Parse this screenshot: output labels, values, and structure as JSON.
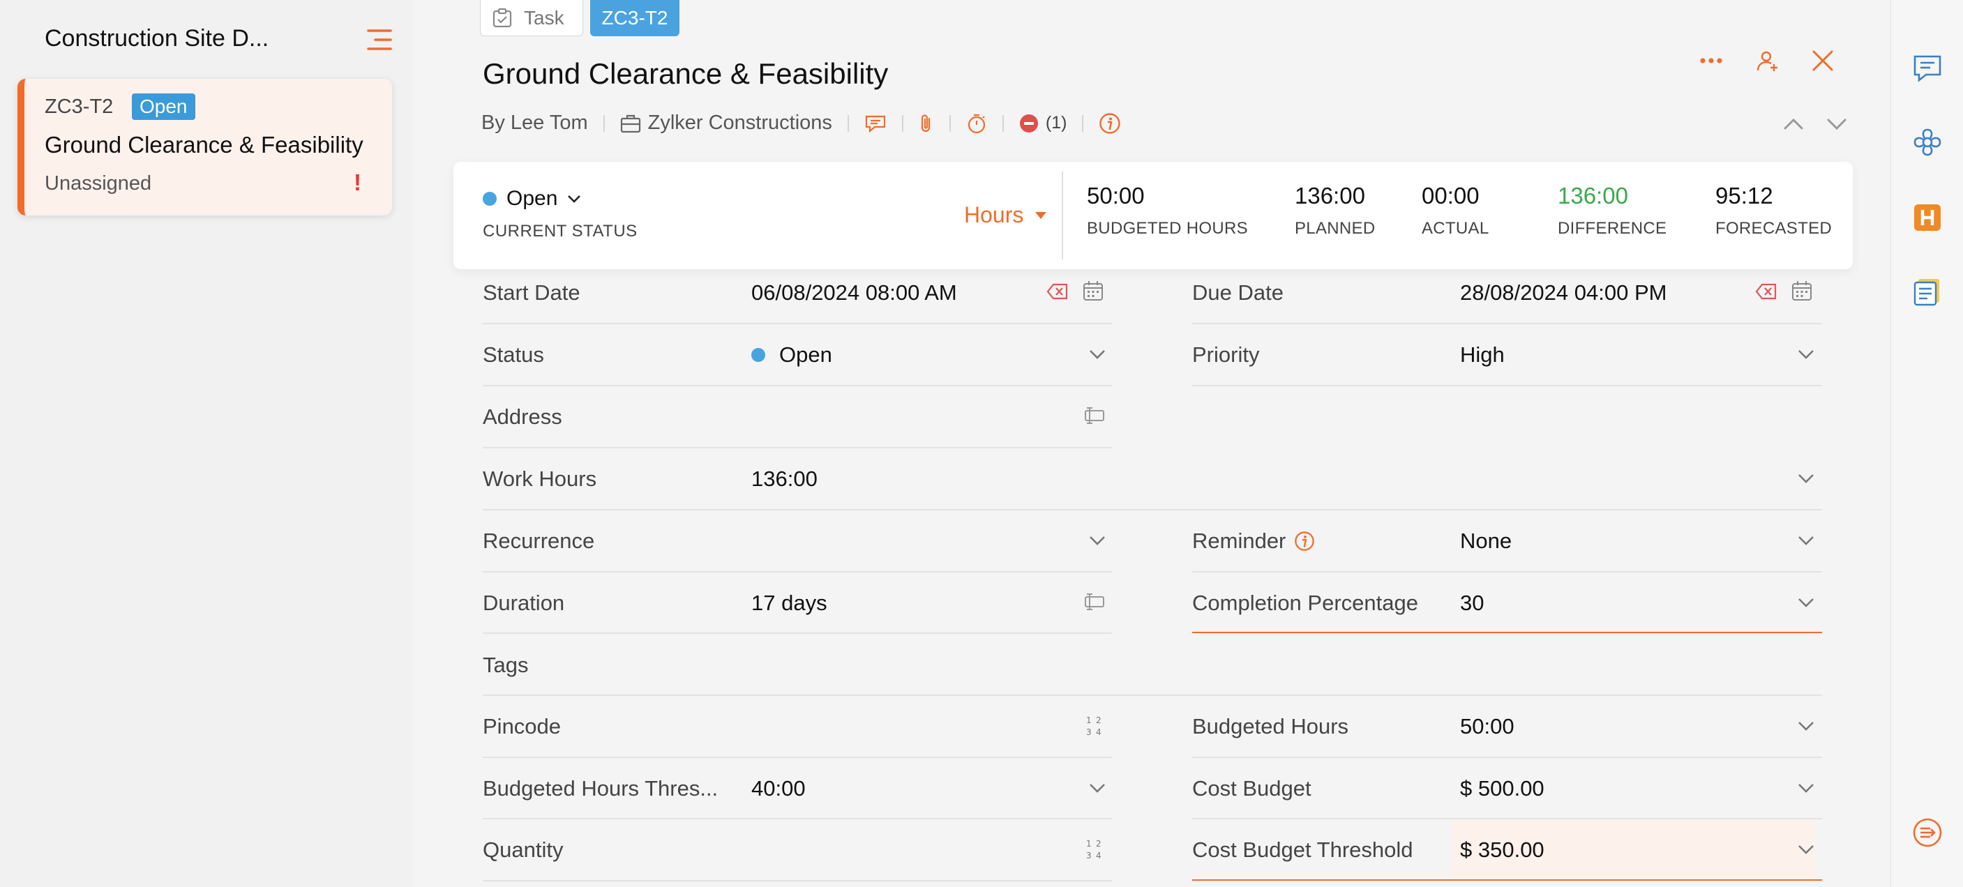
{
  "sidebar": {
    "title": "Construction Site D...",
    "card": {
      "code": "ZC3-T2",
      "status_badge": "Open",
      "name": "Ground Clearance & Feasibility",
      "assignee": "Unassigned",
      "flag": "!"
    }
  },
  "header": {
    "tab_task": "Task",
    "tab_code": "ZC3-T2",
    "title": "Ground Clearance & Feasibility",
    "by": "By Lee Tom",
    "project": "Zylker Constructions",
    "blocker_count": "(1)"
  },
  "summary": {
    "status": "Open",
    "status_label": "CURRENT STATUS",
    "unit": "Hours",
    "metrics": [
      {
        "value": "50:00",
        "label": "BUDGETED HOURS"
      },
      {
        "value": "136:00",
        "label": "PLANNED"
      },
      {
        "value": "00:00",
        "label": "ACTUAL"
      },
      {
        "value": "136:00",
        "label": "DIFFERENCE"
      },
      {
        "value": "95:12",
        "label": "FORECASTED"
      }
    ]
  },
  "fields": {
    "start_date": {
      "label": "Start Date",
      "value": "06/08/2024 08:00 AM"
    },
    "due_date": {
      "label": "Due Date",
      "value": "28/08/2024 04:00 PM"
    },
    "status": {
      "label": "Status",
      "value": "Open"
    },
    "priority": {
      "label": "Priority",
      "value": "High"
    },
    "address": {
      "label": "Address",
      "value": ""
    },
    "work_hours": {
      "label": "Work Hours",
      "value": "136:00"
    },
    "recurrence": {
      "label": "Recurrence",
      "value": ""
    },
    "reminder": {
      "label": "Reminder",
      "value": "None"
    },
    "duration": {
      "label": "Duration",
      "value": "17 days"
    },
    "completion": {
      "label": "Completion Percentage",
      "value": "30"
    },
    "tags": {
      "label": "Tags",
      "value": ""
    },
    "pincode": {
      "label": "Pincode",
      "value": ""
    },
    "budgeted_hours": {
      "label": "Budgeted Hours",
      "value": "50:00"
    },
    "budgeted_threshold": {
      "label": "Budgeted Hours Thres...",
      "value": "40:00"
    },
    "cost_budget": {
      "label": "Cost Budget",
      "value": "$ 500.00"
    },
    "quantity": {
      "label": "Quantity",
      "value": ""
    },
    "cost_threshold": {
      "label": "Cost Budget Threshold",
      "value": "$ 350.00"
    }
  },
  "colors": {
    "accent": "#ef6c2c",
    "status_blue": "#47a4e0",
    "positive_green": "#3aa84a",
    "alert_red": "#e53935"
  },
  "icons": {
    "sidebar": [
      "menu-icon"
    ],
    "header": [
      "more-icon",
      "assign-user-icon",
      "close-icon",
      "comment-icon",
      "attachment-icon",
      "timer-icon",
      "blocker-icon",
      "info-icon",
      "chevron-up-icon",
      "chevron-down-icon"
    ],
    "rail": [
      "chat-icon",
      "integration-icon",
      "hours-icon",
      "notes-icon",
      "collapse-panel-icon"
    ]
  }
}
